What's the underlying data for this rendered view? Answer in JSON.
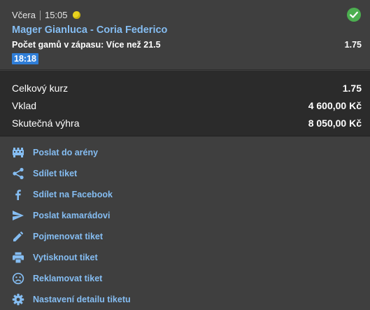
{
  "bet": {
    "day": "Včera",
    "time": "15:05",
    "sport_icon": "tennis-ball-icon",
    "status_icon": "check-circle-icon",
    "match": "Mager Gianluca - Coria Federico",
    "market_label": "Počet gamů v zápasu:",
    "market_value": "Více než 21.5",
    "odd": "1.75",
    "match_time_badge": "18:18"
  },
  "summary": {
    "total_odds_label": "Celkový kurz",
    "total_odds_value": "1.75",
    "stake_label": "Vklad",
    "stake_value": "4 600,00 Kč",
    "win_label": "Skutečná výhra",
    "win_value": "8 050,00 Kč"
  },
  "actions": [
    {
      "label": "Poslat do arény",
      "icon": "arena-icon"
    },
    {
      "label": "Sdílet tiket",
      "icon": "share-icon"
    },
    {
      "label": "Sdílet na Facebook",
      "icon": "facebook-icon"
    },
    {
      "label": "Poslat kamarádovi",
      "icon": "send-icon"
    },
    {
      "label": "Pojmenovat tiket",
      "icon": "pencil-icon"
    },
    {
      "label": "Vytisknout tiket",
      "icon": "printer-icon"
    },
    {
      "label": "Reklamovat tiket",
      "icon": "sad-face-icon"
    },
    {
      "label": "Nastavení detailu tiketu",
      "icon": "gear-icon"
    }
  ],
  "colors": {
    "background": "#3f3f3f",
    "summary_background": "#2b2b2b",
    "link": "#85bdf2",
    "badge": "#2f7ed8",
    "success": "#4caf50",
    "ball": "#e8d21e"
  }
}
